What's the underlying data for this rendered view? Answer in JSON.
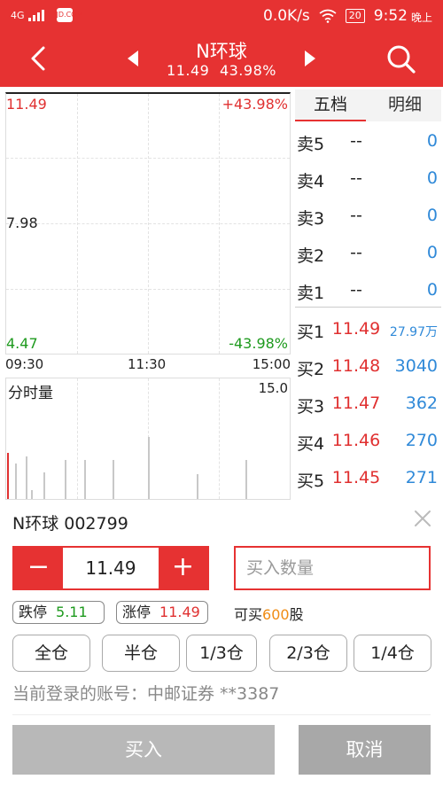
{
  "status_bar": {
    "network": "4G",
    "speed": "0.0K/s",
    "battery": "20",
    "time": "9:52",
    "period": "晚上",
    "app_icon_text": "JD.COM"
  },
  "header": {
    "stock_name": "N环球",
    "price": "11.49",
    "change_pct": "43.98%"
  },
  "price_chart": {
    "top_price": "11.49",
    "top_pct": "+43.98%",
    "mid_price": "7.98",
    "bottom_price": "4.47",
    "bottom_pct": "-43.98%",
    "time_start": "09:30",
    "time_mid": "11:30",
    "time_end": "15:00",
    "volume_label": "分时量",
    "volume_max": "15.0"
  },
  "order_book": {
    "tab_five": "五档",
    "tab_detail": "明细",
    "asks": [
      {
        "label": "卖5",
        "price": "--",
        "volume": "0"
      },
      {
        "label": "卖4",
        "price": "--",
        "volume": "0"
      },
      {
        "label": "卖3",
        "price": "--",
        "volume": "0"
      },
      {
        "label": "卖2",
        "price": "--",
        "volume": "0"
      },
      {
        "label": "卖1",
        "price": "--",
        "volume": "0"
      }
    ],
    "bids": [
      {
        "label": "买1",
        "price": "11.49",
        "volume": "27.97万"
      },
      {
        "label": "买2",
        "price": "11.48",
        "volume": "3040"
      },
      {
        "label": "买3",
        "price": "11.47",
        "volume": "362"
      },
      {
        "label": "买4",
        "price": "11.46",
        "volume": "270"
      },
      {
        "label": "买5",
        "price": "11.45",
        "volume": "271"
      }
    ]
  },
  "order_form": {
    "stock_label": "N环球 002799",
    "minus_label": "−",
    "plus_label": "+",
    "price_value": "11.49",
    "quantity_placeholder": "买入数量",
    "limit_down_label": "跌停",
    "limit_down_value": "5.11",
    "limit_up_label": "涨停",
    "limit_up_value": "11.49",
    "can_buy_prefix": "可买",
    "can_buy_amount": "600",
    "can_buy_unit": "股",
    "positions": [
      "全仓",
      "半仓",
      "1/3仓",
      "2/3仓",
      "1/4仓"
    ],
    "account_text": "当前登录的账号：中邮证券 **3387",
    "buy_label": "买入",
    "cancel_label": "取消"
  },
  "colors": {
    "brand_red": "#e63232",
    "rise_red": "#e03030",
    "fall_green": "#1e9a1e",
    "volume_blue": "#2f89d8",
    "highlight_orange": "#f08c14"
  }
}
